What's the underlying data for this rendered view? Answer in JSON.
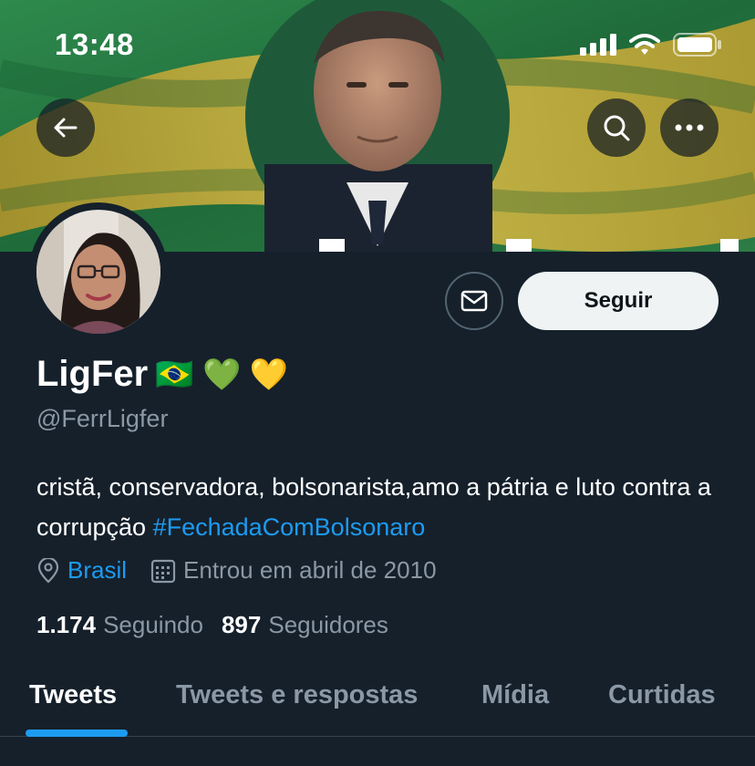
{
  "status_bar": {
    "time": "13:48"
  },
  "header": {
    "back_icon": "arrow-left-icon",
    "search_icon": "search-icon",
    "more_icon": "more-horizontal-icon"
  },
  "profile": {
    "display_name": "LigFer",
    "name_emojis": "🇧🇷 💚 💛",
    "handle": "@FerrLigfer",
    "bio_text": "cristã, conservadora, bolsonarista,amo a pátria e luto contra a corrupção ",
    "bio_hashtag": "#FechadaComBolsonaro",
    "location": "Brasil",
    "joined": "Entrou em abril de 2010",
    "following_count": "1.174",
    "following_label": "Seguindo",
    "followers_count": "897",
    "followers_label": "Seguidores"
  },
  "actions": {
    "message_icon": "mail-icon",
    "follow_label": "Seguir"
  },
  "tabs": [
    {
      "label": "Tweets",
      "active": true
    },
    {
      "label": "Tweets e respostas",
      "active": false
    },
    {
      "label": "Mídia",
      "active": false
    },
    {
      "label": "Curtidas",
      "active": false
    }
  ],
  "colors": {
    "background": "#15202b",
    "accent": "#1d9bf0",
    "secondary_text": "#8b98a5",
    "follow_button_bg": "#eff3f4"
  }
}
